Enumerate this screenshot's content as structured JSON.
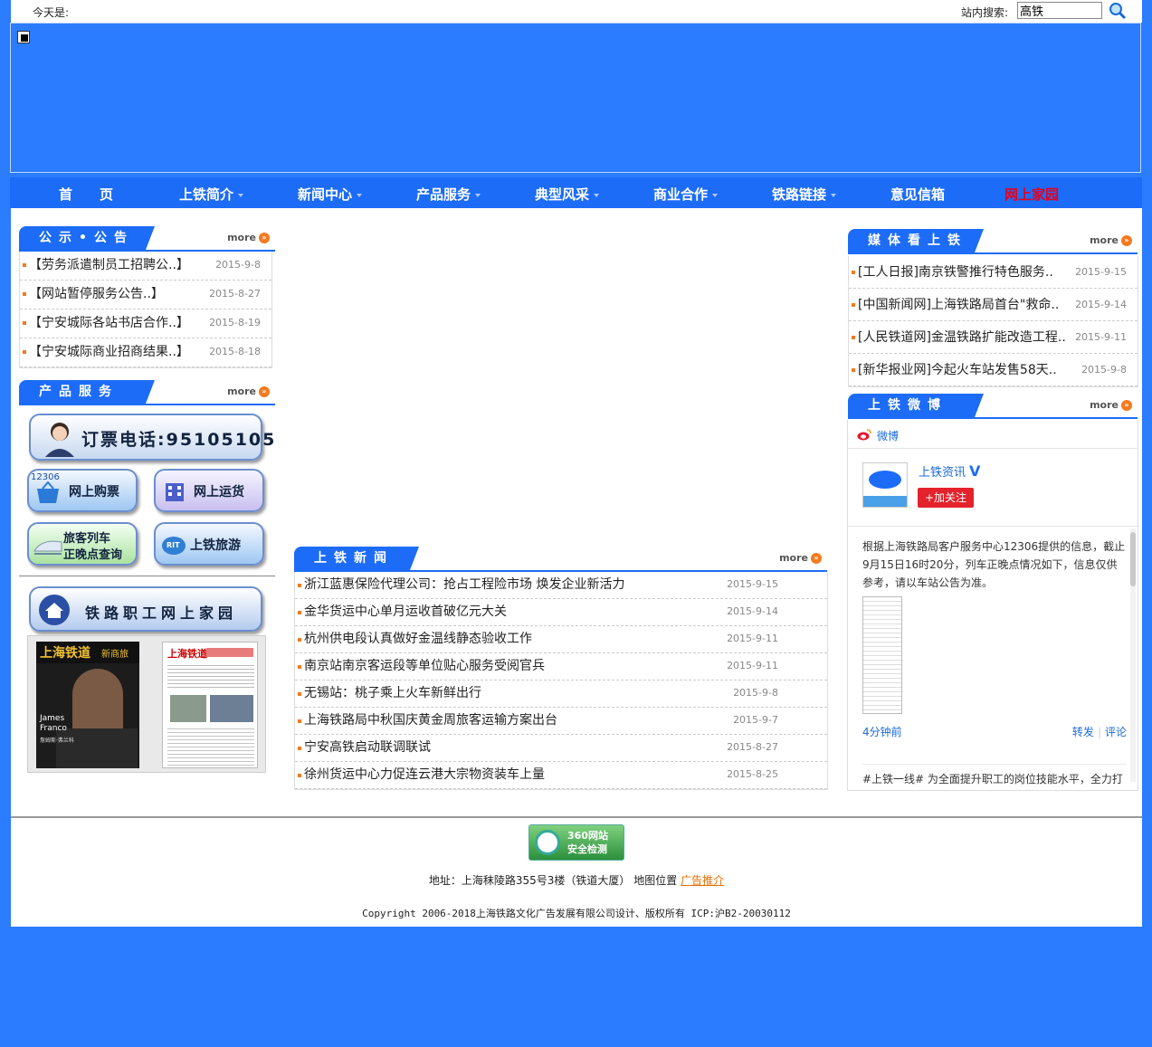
{
  "topbar": {
    "today_label": "今天是:",
    "search_label": "站内搜索:",
    "search_value": "高铁"
  },
  "nav": {
    "items": [
      {
        "label": "首　　页"
      },
      {
        "label": "上铁简介"
      },
      {
        "label": "新闻中心"
      },
      {
        "label": "产品服务"
      },
      {
        "label": "典型风采"
      },
      {
        "label": "商业合作"
      },
      {
        "label": "铁路链接"
      },
      {
        "label": "意见信箱"
      },
      {
        "label": "网上家园"
      }
    ]
  },
  "more_label": "more",
  "notice": {
    "title": "公示•公告",
    "rows": [
      {
        "text": "【劳务派遣制员工招聘公..】",
        "date": "2015-9-8"
      },
      {
        "text": "【网站暂停服务公告..】",
        "date": "2015-8-27"
      },
      {
        "text": "【宁安城际各站书店合作..】",
        "date": "2015-8-19"
      },
      {
        "text": "【宁安城际商业招商结果..】",
        "date": "2015-8-18"
      }
    ]
  },
  "products": {
    "title": "产品服务",
    "phone_label": "订票电话:95105105",
    "buy_ticket": "网上购票",
    "buy_ticket_logo": "12306",
    "freight": "网上运货",
    "train_line1": "旅客列车",
    "train_line2": "正晚点查询",
    "travel": "上铁旅游",
    "travel_logo": "RIT",
    "home_label": "铁路职工网上家园"
  },
  "magazines": {
    "left_title": "上海铁道",
    "left_sub": "新商旅",
    "left_name1": "James",
    "left_name2": "Franco",
    "left_caption": "詹姆斯·弗兰科",
    "right_title": "上海铁道"
  },
  "news": {
    "title": "上铁新闻",
    "rows": [
      {
        "text": "浙江蓝惠保险代理公司：抢占工程险市场 焕发企业新活力",
        "date": "2015-9-15"
      },
      {
        "text": "金华货运中心单月运收首破亿元大关",
        "date": "2015-9-14"
      },
      {
        "text": "杭州供电段认真做好金温线静态验收工作",
        "date": "2015-9-11"
      },
      {
        "text": "南京站南京客运段等单位贴心服务受阅官兵",
        "date": "2015-9-11"
      },
      {
        "text": "无锡站：桃子乘上火车新鲜出行",
        "date": "2015-9-8"
      },
      {
        "text": "上海铁路局中秋国庆黄金周旅客运输方案出台",
        "date": "2015-9-7"
      },
      {
        "text": "宁安高铁启动联调联试",
        "date": "2015-8-27"
      },
      {
        "text": "徐州货运中心力促连云港大宗物资装车上量",
        "date": "2015-8-25"
      }
    ]
  },
  "media": {
    "title": "媒体看上铁",
    "rows": [
      {
        "text": "[工人日报]南京铁警推行特色服务..",
        "date": "2015-9-15"
      },
      {
        "text": "[中国新闻网]上海铁路局首台\"救命..",
        "date": "2015-9-14"
      },
      {
        "text": "[人民铁道网]金温铁路扩能改造工程..",
        "date": "2015-9-11"
      },
      {
        "text": "[新华报业网]今起火车站发售58天..",
        "date": "2015-9-8"
      }
    ]
  },
  "weibo": {
    "title": "上铁微博",
    "brand": "微博",
    "account": "上铁资讯",
    "verified": "V",
    "follow": "+加关注",
    "post": "根据上海铁路局客户服务中心12306提供的信息，截止9月15日16时20分，列车正晚点情况如下，信息仅供参考，请以车站公告为准。",
    "time": "4分钟前",
    "forward": "转发",
    "comment": "评论",
    "post2": "#上铁一线# 为全面提升职工的岗位技能水平，全力打造一支安全生产素质过硬的职工队伍，日前，南京供电段"
  },
  "footer": {
    "badge_line1": "360网站",
    "badge_line2": "安全检测",
    "address": "地址：上海秣陵路355号3楼（铁道大厦） 地图位置",
    "ad_link": "广告推介",
    "copyright": "Copyright 2006-2018上海铁路文化广告发展有限公司设计、版权所有 ICP:沪B2-20030112"
  }
}
